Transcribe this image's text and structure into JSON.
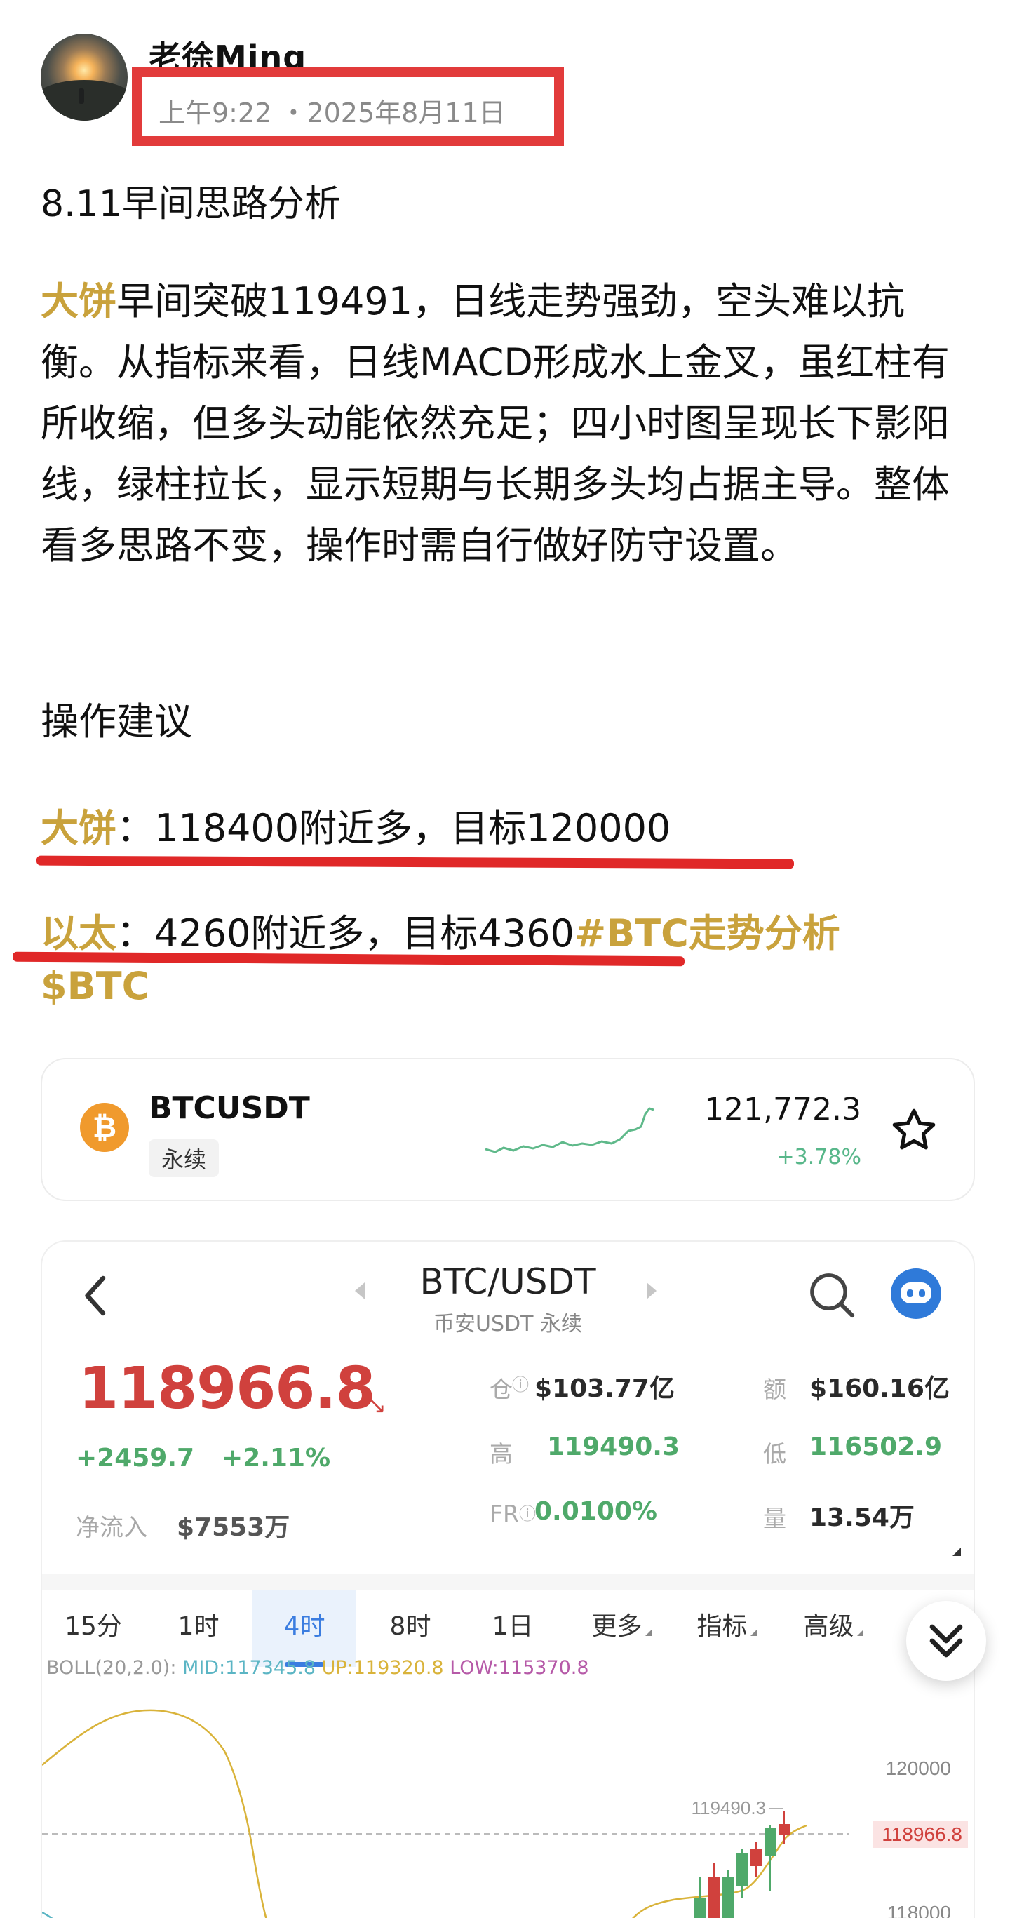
{
  "post": {
    "author": "老徐Ming",
    "meta": "上午9:22 ・2025年8月11日",
    "title": "8.11早间思路分析",
    "para_highlight": "大饼",
    "para_text": "早间突破119491，日线走势强劲，空头难以抗衡。从指标来看，日线MACD形成水上金叉，虽红柱有所收缩，但多头动能依然充足；四小时图呈现长下影阳线，绿柱拉长，显示短期与长期多头均占据主导。整体看多思路不变，操作时需自行做好防守设置。",
    "advice_heading": "操作建议",
    "rec1_label": "大饼",
    "rec1_text": "：118400附近多，目标120000",
    "rec2_label": "以太",
    "rec2_text": "：4260附近多，目标4360",
    "hashtag": "#BTC走势分析",
    "cashtag": "$BTC"
  },
  "ticker": {
    "symbol": "BTCUSDT",
    "type": "永续",
    "price": "121,772.3",
    "change": "+3.78%",
    "coin_glyph": "₿"
  },
  "market": {
    "pair": "BTC/USDT",
    "exchange": "币安USDT 永续",
    "price": "118966.8",
    "price_arrow": "↘",
    "change_abs": "+2459.7",
    "change_pct": "+2.11%",
    "inflow_label": "净流入",
    "inflow_value": "$7553万",
    "oi_label": "仓",
    "oi_value": "$103.77亿",
    "amount_label": "额",
    "amount_value": "$160.16亿",
    "high_label": "高",
    "high_value": "119490.3",
    "low_label": "低",
    "low_value": "116502.9",
    "fr_label": "FR",
    "fr_value": "0.0100%",
    "vol_label": "量",
    "vol_value": "13.54万"
  },
  "tabs": [
    "15分",
    "1时",
    "4时",
    "8时",
    "1日",
    "更多",
    "指标",
    "高级"
  ],
  "active_tab": "4时",
  "boll": {
    "prefix": "BOLL(20,2.0):",
    "mid": "MID:117345.8",
    "up": "UP:119320.8",
    "low": "LOW:115370.8"
  },
  "chart_labels": {
    "y_top": "120000",
    "y_bottom": "118000",
    "current": "118966.8",
    "high_marker": "119490.3"
  },
  "colors": {
    "gold": "#c9a23c",
    "red_price": "#d0413d",
    "green": "#4fa96a",
    "blue": "#3b7de0",
    "mid_line": "#5bb5c4",
    "up_line": "#d9b33a",
    "low_line": "#b65aa8"
  }
}
